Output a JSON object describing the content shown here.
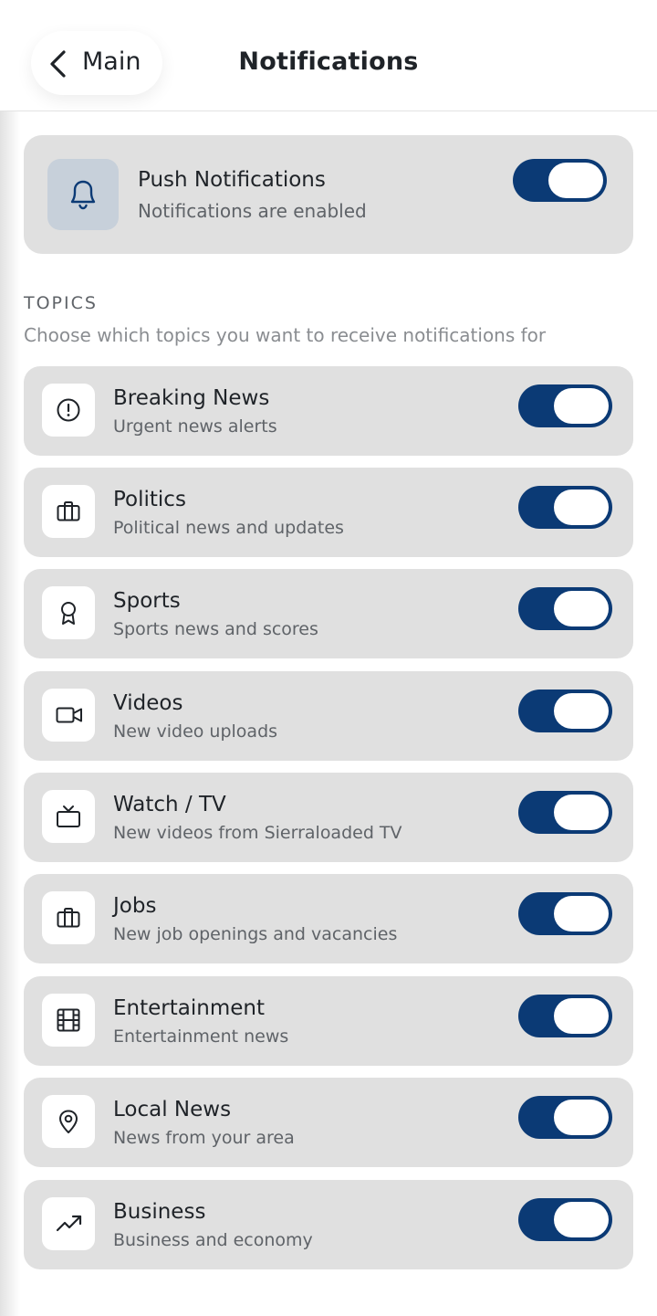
{
  "header": {
    "back_label": "Main",
    "title": "Notifications"
  },
  "push": {
    "title": "Push Notifications",
    "status": "Notifications are enabled",
    "enabled": true,
    "icon": "bell-icon"
  },
  "topics": {
    "heading": "TOPICS",
    "description": "Choose which topics you want to receive notifications for",
    "items": [
      {
        "title": "Breaking News",
        "subtitle": "Urgent news alerts",
        "icon": "alert-circle-icon",
        "enabled": true
      },
      {
        "title": "Politics",
        "subtitle": "Political news and updates",
        "icon": "briefcase-icon",
        "enabled": true
      },
      {
        "title": "Sports",
        "subtitle": "Sports news and scores",
        "icon": "award-icon",
        "enabled": true
      },
      {
        "title": "Videos",
        "subtitle": "New video uploads",
        "icon": "video-camera-icon",
        "enabled": true
      },
      {
        "title": "Watch / TV",
        "subtitle": "New videos from Sierraloaded TV",
        "icon": "tv-icon",
        "enabled": true
      },
      {
        "title": "Jobs",
        "subtitle": "New job openings and vacancies",
        "icon": "briefcase-icon",
        "enabled": true
      },
      {
        "title": "Entertainment",
        "subtitle": "Entertainment news",
        "icon": "film-icon",
        "enabled": true
      },
      {
        "title": "Local News",
        "subtitle": "News from your area",
        "icon": "map-pin-icon",
        "enabled": true
      },
      {
        "title": "Business",
        "subtitle": "Business and economy",
        "icon": "trending-up-icon",
        "enabled": true
      }
    ]
  },
  "colors": {
    "accent": "#0b3a75",
    "card_bg": "#e0e0e0",
    "bell_bg": "#c7d0da"
  }
}
